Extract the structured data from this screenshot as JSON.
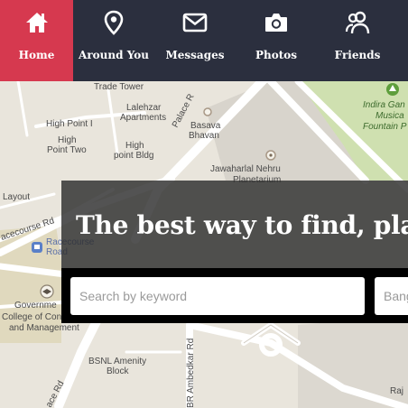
{
  "nav": {
    "items": [
      {
        "label": "Home",
        "icon": "home-icon",
        "active": true
      },
      {
        "label": "Around You",
        "icon": "location-pin-icon",
        "active": false
      },
      {
        "label": "Messages",
        "icon": "envelope-icon",
        "active": false
      },
      {
        "label": "Photos",
        "icon": "camera-icon",
        "active": false
      },
      {
        "label": "Friends",
        "icon": "friends-icon",
        "active": false
      }
    ],
    "colors": {
      "background": "#2b2f3e",
      "active": "#d6394f"
    }
  },
  "map": {
    "labels": {
      "trade_tower": "Trade Tower",
      "lalehzar_1": "Lalehzar",
      "lalehzar_2": "Apartments",
      "palace_rd_1": "Palace R",
      "high_point_i": "High Point I",
      "high_1": "High",
      "point_two": "Point Two",
      "high_2": "High",
      "point_bldg": "point Bldg",
      "basava_1": "Basava",
      "basava_2": "Bhavan",
      "jawaharlal_1": "Jawaharlal Nehru",
      "jawaharlal_2": "Planetarium",
      "indira_1": "Indira Gan",
      "indira_2": "Musica",
      "indira_3": "Fountain P",
      "layout": "Layout",
      "racecourse_rd": "acecourse Rd",
      "racecourse_road_1": "Racecourse",
      "racecourse_road_2": "Road",
      "govt_1": "Governme",
      "govt_2": "College of Con",
      "govt_3": "and Management",
      "bsnl_1": "BSNL Amenity",
      "bsnl_2": "Block",
      "br_ambedkar": "BR Ambedkar Rd",
      "raj": "Raj",
      "race_rd": "ace Rd"
    }
  },
  "hero": {
    "title": "The best way to find, place",
    "search": {
      "keyword_placeholder": "Search by keyword",
      "location_placeholder": "Bang"
    }
  }
}
